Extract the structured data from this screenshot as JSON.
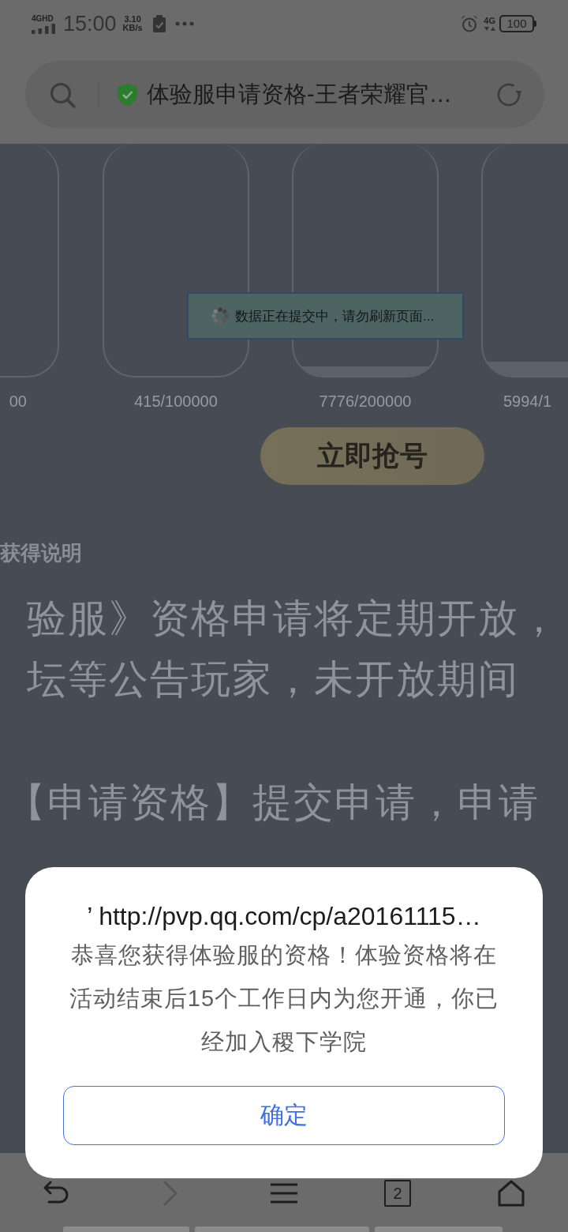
{
  "status_bar": {
    "network": "4GHD",
    "time": "15:00",
    "speed": "3.10",
    "speed_unit": "KB/s",
    "mobile_data": "4G",
    "battery": "100"
  },
  "address_bar": {
    "title": "体验服申请资格-王者荣耀官…"
  },
  "page": {
    "cards": [
      {
        "label": "00"
      },
      {
        "label": "415/100000"
      },
      {
        "label": "7776/200000",
        "level": 0.04
      },
      {
        "label": "5994/1",
        "level": 0.06
      }
    ],
    "grab_button": {
      "label": "立即抢号"
    },
    "section_title": "获得说明",
    "lines": [
      "验服》资格申请将定期开放，",
      "坛等公告玩家，未开放期间",
      "【申请资格】提交申请，申请"
    ]
  },
  "toast": {
    "text": "数据正在提交中，请勿刷新页面..."
  },
  "dialog": {
    "title": "’ http://pvp.qq.com/cp/a20161115…",
    "message": "恭喜您获得体验服的资格！体验资格将在活动结束后15个工作日内为您开通，你已经加入稷下学院",
    "button": "确定"
  },
  "bottom_nav": {
    "forward": {
      "disabled": true
    },
    "tabs_count": "2"
  }
}
